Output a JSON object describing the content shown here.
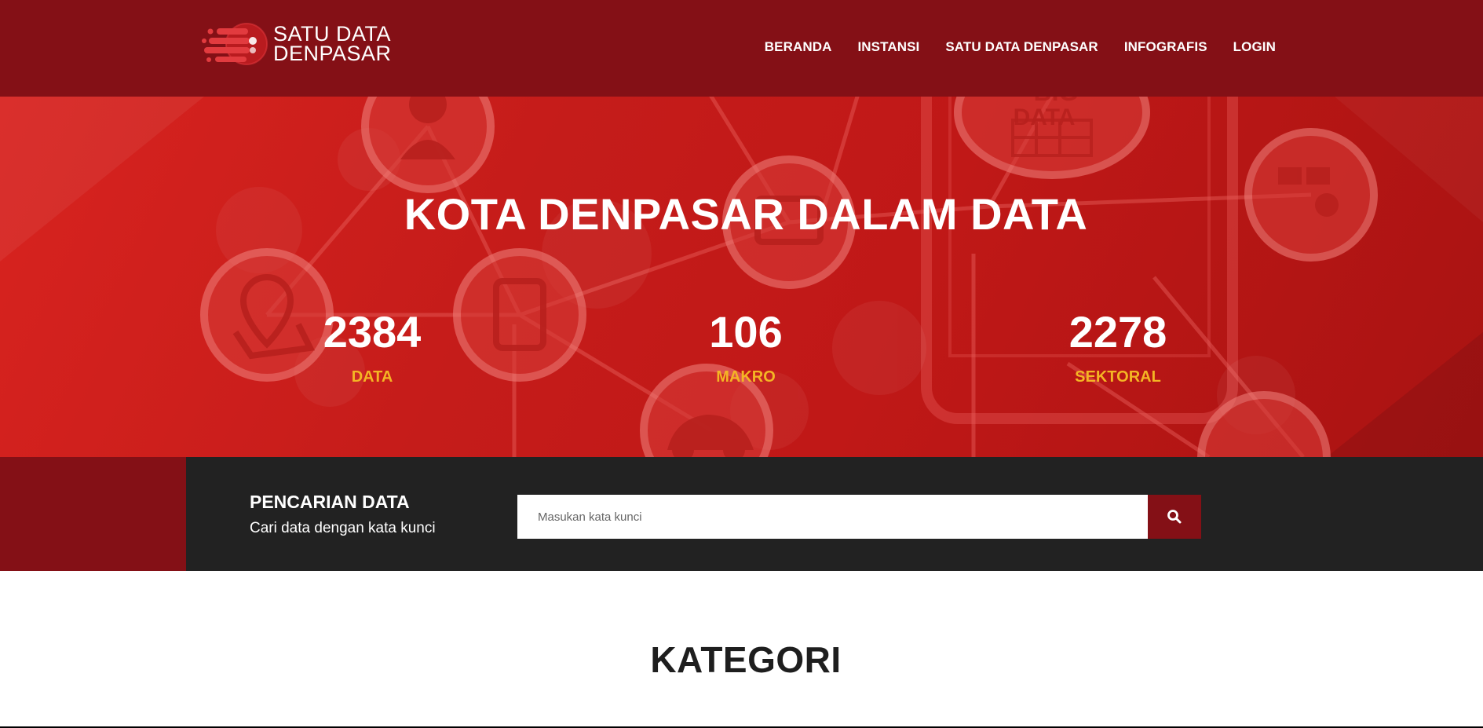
{
  "header": {
    "logo": {
      "line1": "SATU DATA",
      "line2": "DENPASAR"
    },
    "nav": [
      {
        "label": "BERANDA"
      },
      {
        "label": "INSTANSI"
      },
      {
        "label": "SATU DATA DENPASAR"
      },
      {
        "label": "INFOGRAFIS"
      },
      {
        "label": "LOGIN"
      }
    ]
  },
  "hero": {
    "title": "KOTA DENPASAR DALAM DATA",
    "background_texts": [
      "BIG",
      "DATA"
    ],
    "stats": [
      {
        "value": "2384",
        "label": "DATA"
      },
      {
        "value": "106",
        "label": "MAKRO"
      },
      {
        "value": "2278",
        "label": "SEKTORAL"
      }
    ]
  },
  "search": {
    "title": "PENCARIAN DATA",
    "subtitle": "Cari data dengan kata kunci",
    "placeholder": "Masukan kata kunci",
    "value": "",
    "button_icon": "search-icon"
  },
  "kategori": {
    "title": "KATEGORI"
  },
  "colors": {
    "header_bg": "#841016",
    "hero_red": "#c51c1a",
    "stat_label": "#f4b524",
    "search_band": "#222222",
    "search_button": "#841016"
  }
}
